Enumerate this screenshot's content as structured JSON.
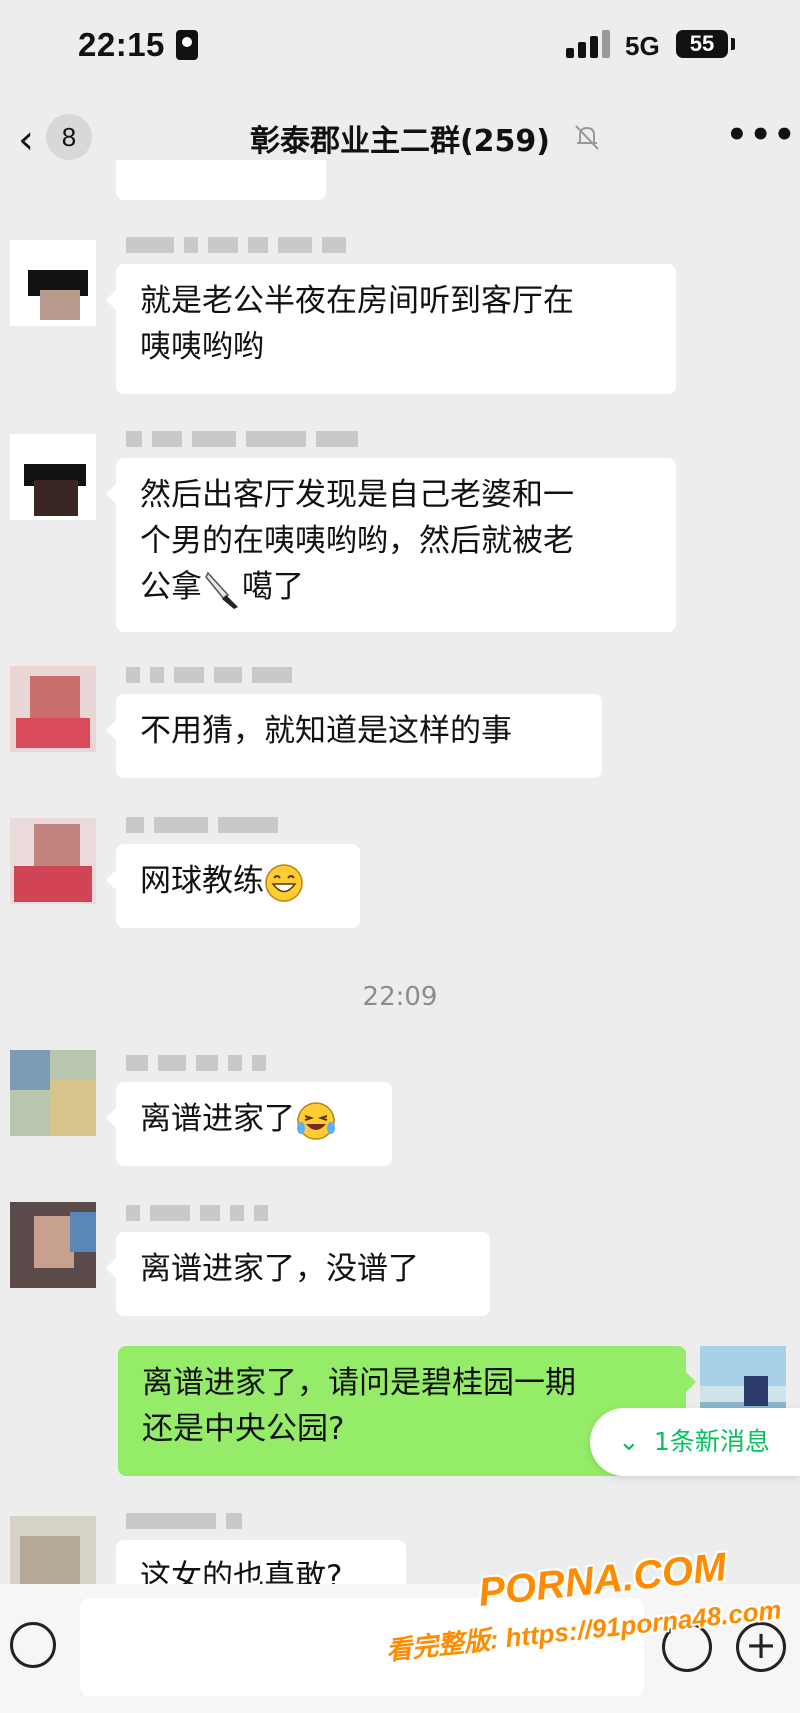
{
  "status_bar": {
    "time": "22:15",
    "network": "5G",
    "battery": "55"
  },
  "nav": {
    "back_count": "8",
    "title": "彰泰郡业主二群(259)"
  },
  "messages": [
    {
      "text_lines": [
        "就是老公半夜在房间听到客厅在",
        "咦咦哟哟"
      ]
    },
    {
      "text_lines": [
        "然后出客厅发现是自己老婆和一",
        "个男的在咦咦哟哟，然后就被老",
        "公拿",
        "噶了"
      ]
    },
    {
      "text": "不用猜，就知道是这样的事"
    },
    {
      "text": "网球教练"
    },
    {
      "text": "离谱进家了"
    },
    {
      "text": "离谱进家了，没谱了"
    },
    {
      "text_lines": [
        "离谱进家了，请问是碧桂园一期",
        "还是中央公园?"
      ]
    },
    {
      "text": "这女的也真敢?"
    }
  ],
  "time_divider": "22:09",
  "new_messages_pill": "1条新消息",
  "watermark": {
    "logo": "PORNA.COM",
    "url": "看完整版: https://91porna48.com"
  },
  "icons": [
    "back-icon",
    "mute-icon",
    "more-icon",
    "knife-emoji-icon",
    "grin-emoji-icon",
    "laughing-emoji-icon",
    "voice-icon",
    "emoji-icon",
    "plus-icon",
    "chevron-down-icon"
  ],
  "colors": {
    "background": "#ededed",
    "bubble_in": "#ffffff",
    "bubble_out": "#95ec69",
    "accent": "#07c160",
    "watermark": "#ff8c00"
  }
}
